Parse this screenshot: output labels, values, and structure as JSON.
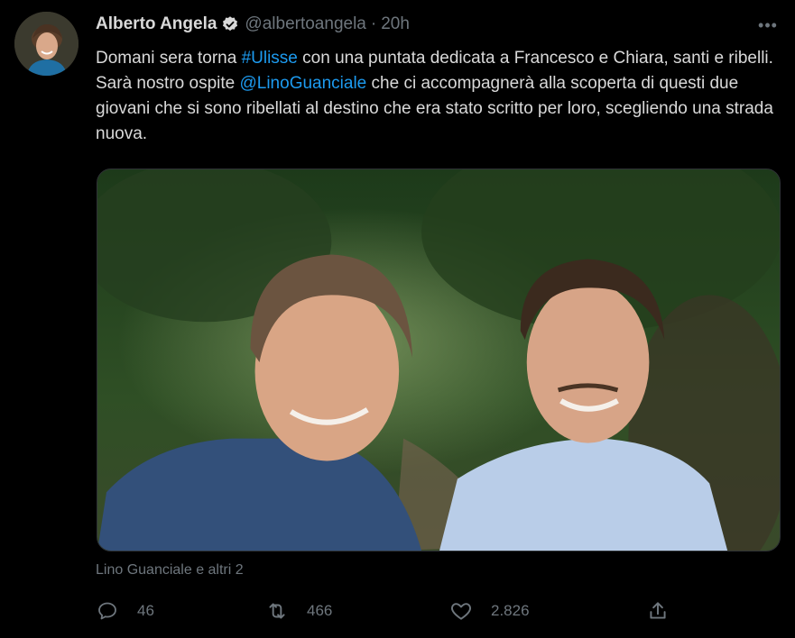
{
  "tweet": {
    "author_name": "Alberto Angela",
    "handle": "@albertoangela",
    "separator": "·",
    "time": "20h",
    "more_label": "•••",
    "text": {
      "part1": "Domani sera torna ",
      "hashtag": "#Ulisse",
      "part2": " con una puntata dedicata a Francesco e Chiara, santi e ribelli. Sarà nostro ospite ",
      "mention": "@LinoGuanciale",
      "part3": " che ci accompagnerà alla scoperta di questi due giovani che si sono ribellati al destino che era stato scritto per loro, scegliendo una strada nuova."
    },
    "tagged": "Lino Guanciale e altri 2",
    "actions": {
      "replies": "46",
      "retweets": "466",
      "likes": "2.826"
    },
    "icons": {
      "verified": "verified-badge-icon",
      "reply": "reply-icon",
      "retweet": "retweet-icon",
      "like": "heart-icon",
      "share": "share-icon"
    },
    "colors": {
      "background": "#000000",
      "text": "#d9d9d9",
      "secondary": "#6e767d",
      "link": "#1d9bf0"
    }
  }
}
